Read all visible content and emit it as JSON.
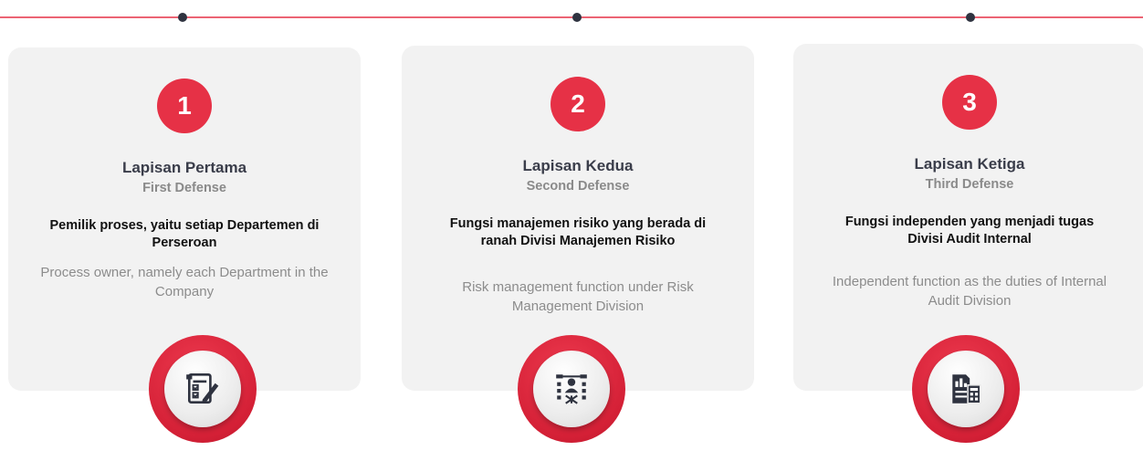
{
  "colors": {
    "accent": "#e63146",
    "card_bg": "#f2f2f2",
    "title": "#3a3d4a",
    "subtitle": "#8a8a8a",
    "body_strong": "#111111",
    "body_muted": "#8c8c8c",
    "timeline_dot": "#2f3340"
  },
  "layers": [
    {
      "number": "1",
      "title": "Lapisan Pertama",
      "subtitle": "First Defense",
      "description_id": "Pemilik proses, yaitu setiap Departemen di Perseroan",
      "description_en": "Process owner, namely each Department in the Company",
      "icon": "checklist-pen-icon"
    },
    {
      "number": "2",
      "title": "Lapisan Kedua",
      "subtitle": "Second Defense",
      "description_id": "Fungsi manajemen risiko yang berada di ranah Divisi Manajemen Risiko",
      "description_en": "Risk management function under Risk Management Division",
      "icon": "team-network-icon"
    },
    {
      "number": "3",
      "title": "Lapisan Ketiga",
      "subtitle": "Third Defense",
      "description_id": "Fungsi independen yang menjadi tugas Divisi Audit Internal",
      "description_en": "Independent function as the duties of Internal Audit Division",
      "icon": "audit-report-icon"
    }
  ]
}
